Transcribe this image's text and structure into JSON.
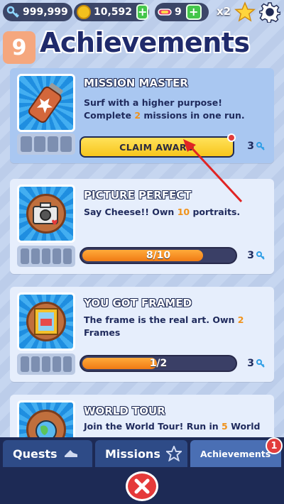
{
  "topbar": {
    "keys": "999,999",
    "coins": "10,592",
    "hoverboards": "9",
    "multiplier": "x2",
    "icons": {
      "keys": "key-icon",
      "coins": "coin-icon",
      "hoverboard": "hoverboard-icon",
      "star": "star-icon",
      "settings": "gear-icon"
    }
  },
  "header": {
    "level": "9",
    "title": "Achievements"
  },
  "achievements": [
    {
      "title": "MISSION MASTER",
      "desc_a": "Surf with a higher purpose! Complete ",
      "desc_hl": "2",
      "desc_b": " missions in one run.",
      "action": "CLAIM AWARD",
      "reward": "3",
      "icon": "spray-can-icon"
    },
    {
      "title": "PICTURE PERFECT",
      "desc_a": "Say Cheese!! Own ",
      "desc_hl": "10",
      "desc_b": " portraits.",
      "progress_text": "8/10",
      "progress": 0.8,
      "reward": "3",
      "icon": "camera-icon"
    },
    {
      "title": "YOU GOT FRAMED",
      "desc_a": "The frame is the real art. Own ",
      "desc_hl": "2",
      "desc_b": " Frames",
      "progress_text": "1/2",
      "progress": 0.5,
      "reward": "3",
      "icon": "picture-frame-icon"
    },
    {
      "title": "WORLD TOUR",
      "desc_a": "Join the World Tour! Run in ",
      "desc_hl": "5",
      "desc_b": " World",
      "icon": "globe-icon"
    }
  ],
  "bottom_nav": {
    "tabs": [
      {
        "label": "Quests",
        "icon": "sneaker-icon"
      },
      {
        "label": "Missions",
        "icon": "star-outline-icon"
      },
      {
        "label": "Achievements",
        "icon": "trophy-icon",
        "badge": "1"
      }
    ],
    "close_icon": "close-icon"
  },
  "colors": {
    "title": "#1f2a6b",
    "highlight": "#f0921b",
    "claim": "#f7c51c",
    "progress": "#f07a14",
    "nav": "#1d2a55",
    "close": "#e53a3a"
  }
}
